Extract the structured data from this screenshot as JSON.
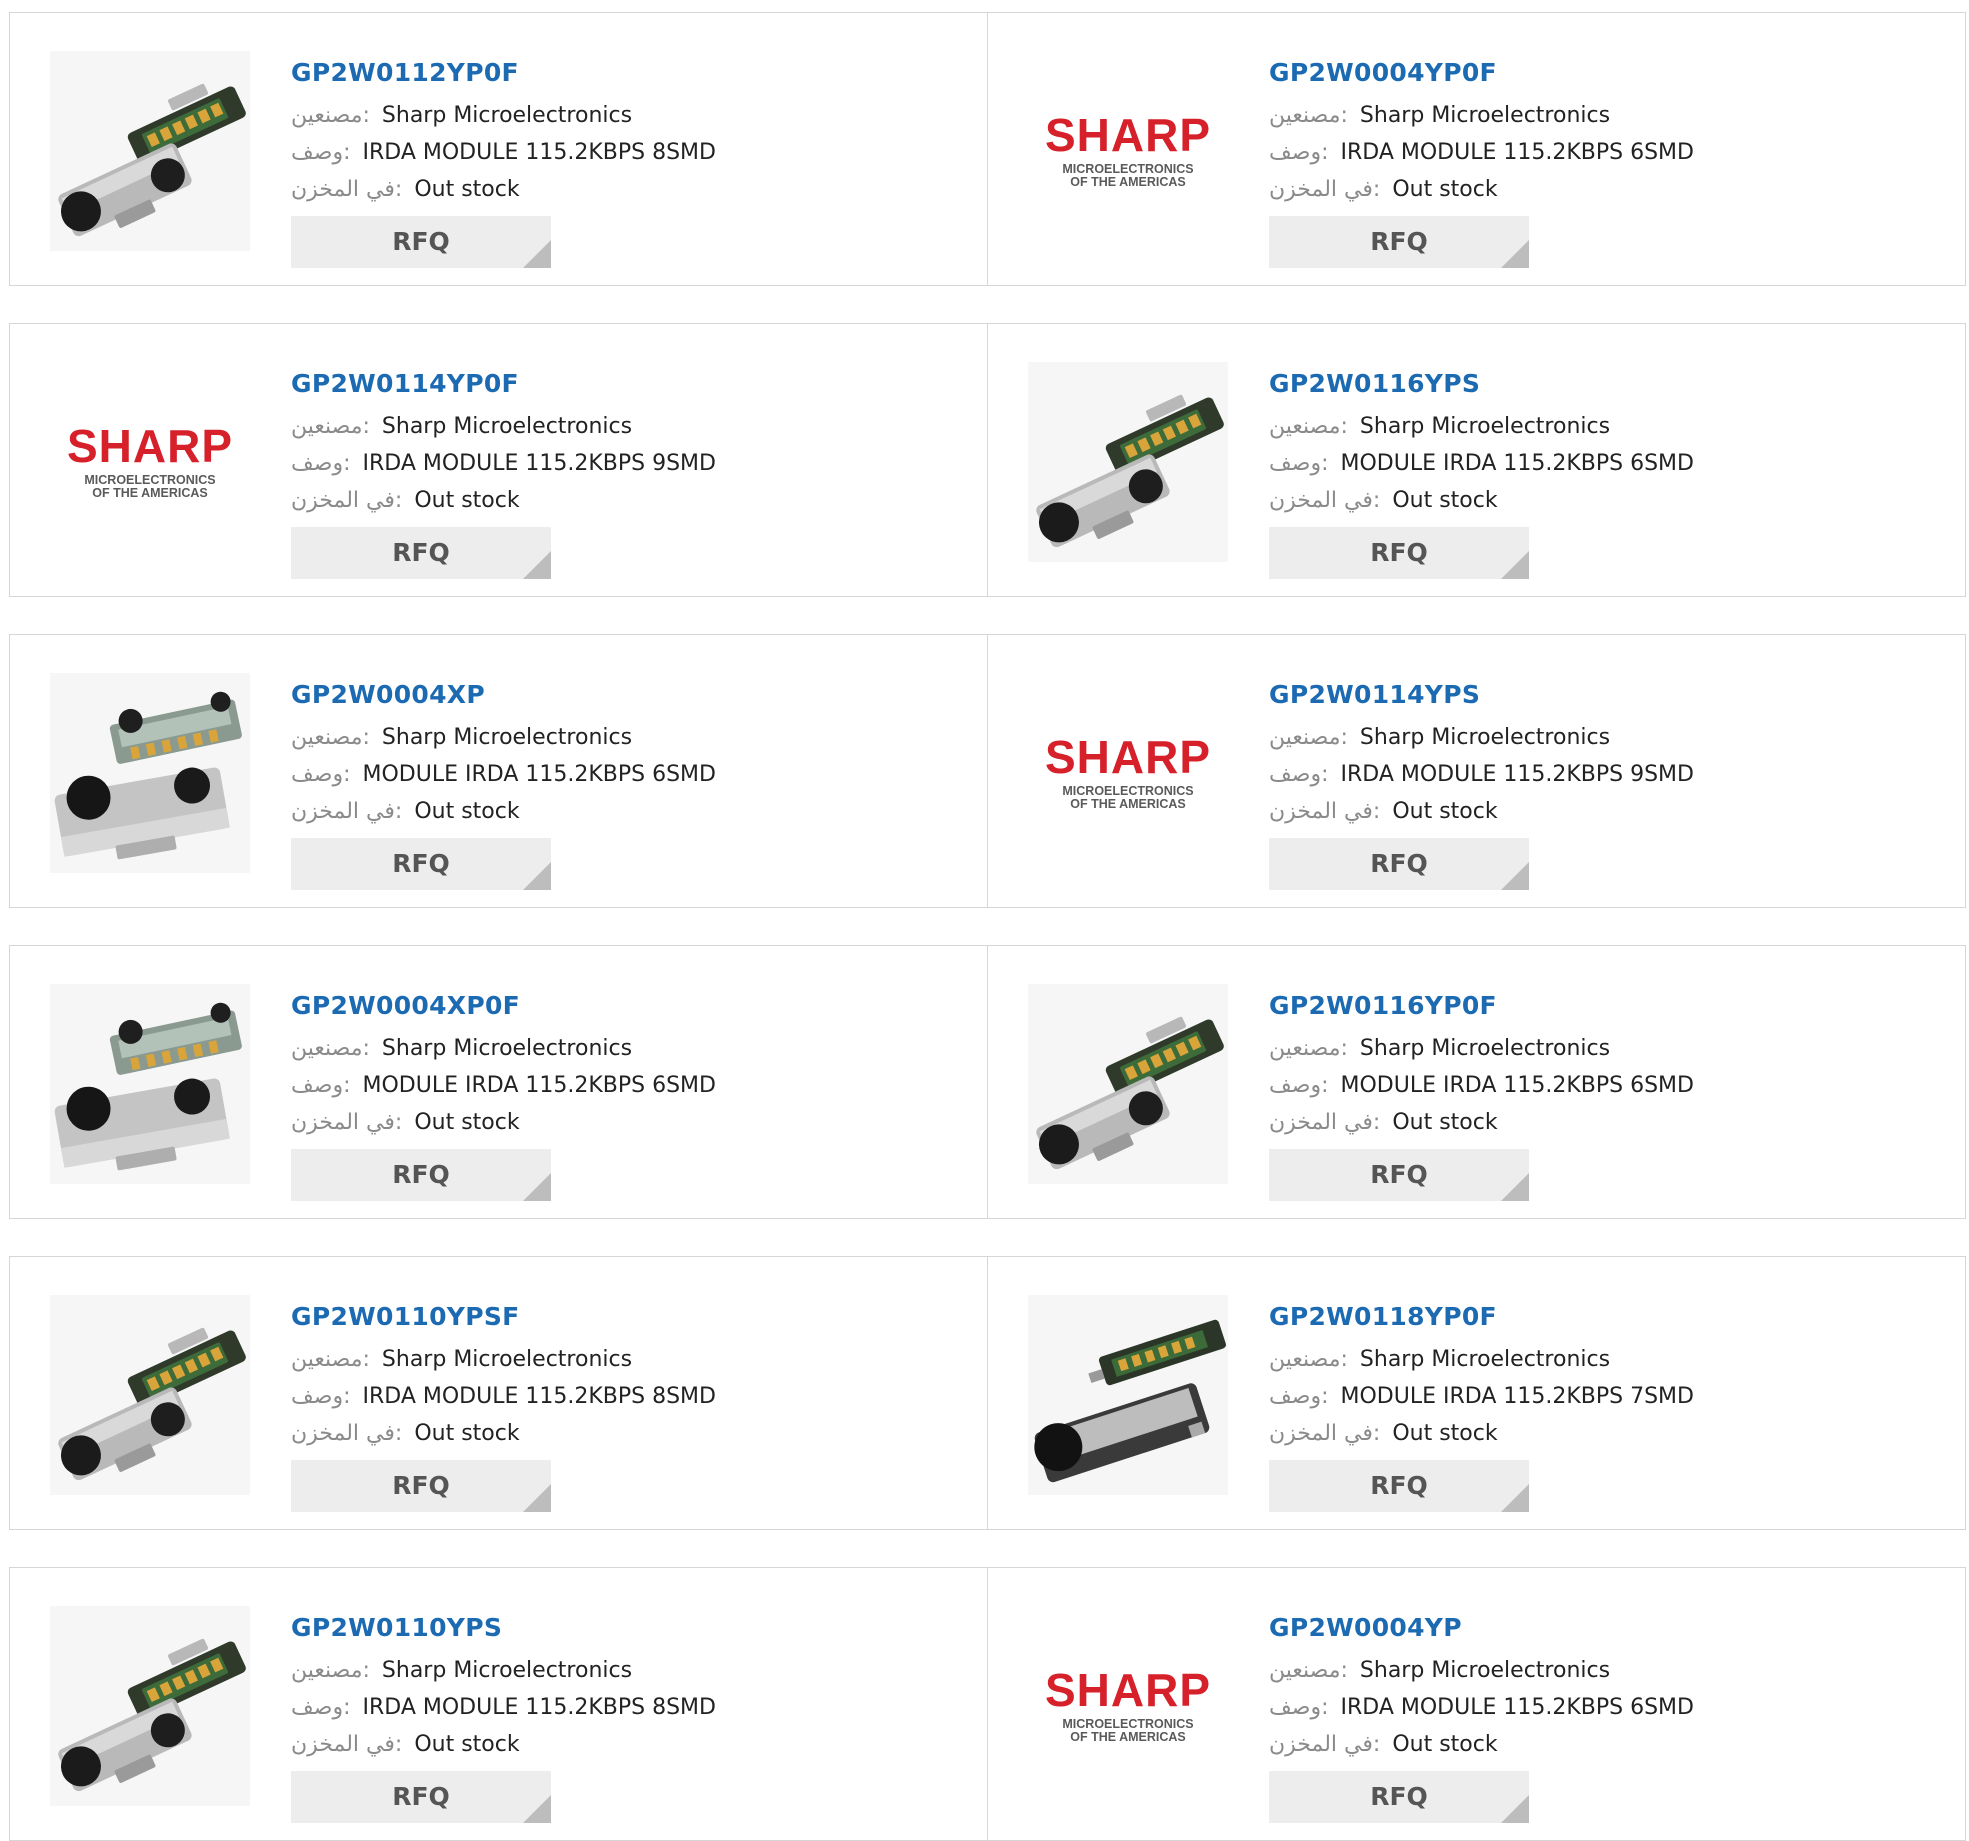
{
  "labels": {
    "manufacturer": "مصنعين:",
    "description": "وصف:",
    "stock": "في المخزن:",
    "rfq": "RFQ"
  },
  "logo": {
    "brand": "SHARP",
    "line1": "MICROELECTRONICS",
    "line2": "OF THE AMERICAS",
    "brand_color": "#d6202a"
  },
  "colors": {
    "part_link": "#1b6ab2",
    "border": "#d6d6d6",
    "rfq_bg": "#ededed"
  },
  "products": [
    {
      "part": "GP2W0112YP0F",
      "manufacturer": "Sharp Microelectronics",
      "description": "IRDA MODULE 115.2KBPS 8SMD",
      "stock": "Out stock",
      "image": "irda-module-diagonal"
    },
    {
      "part": "GP2W0004YP0F",
      "manufacturer": "Sharp Microelectronics",
      "description": "IRDA MODULE 115.2KBPS 6SMD",
      "stock": "Out stock",
      "image": "sharp-logo"
    },
    {
      "part": "GP2W0114YP0F",
      "manufacturer": "Sharp Microelectronics",
      "description": "IRDA MODULE 115.2KBPS 9SMD",
      "stock": "Out stock",
      "image": "sharp-logo"
    },
    {
      "part": "GP2W0116YPS",
      "manufacturer": "Sharp Microelectronics",
      "description": "MODULE IRDA 115.2KBPS 6SMD",
      "stock": "Out stock",
      "image": "irda-module-diagonal"
    },
    {
      "part": "GP2W0004XP",
      "manufacturer": "Sharp Microelectronics",
      "description": "MODULE IRDA 115.2KBPS 6SMD",
      "stock": "Out stock",
      "image": "irda-module-flat"
    },
    {
      "part": "GP2W0114YPS",
      "manufacturer": "Sharp Microelectronics",
      "description": "IRDA MODULE 115.2KBPS 9SMD",
      "stock": "Out stock",
      "image": "sharp-logo"
    },
    {
      "part": "GP2W0004XP0F",
      "manufacturer": "Sharp Microelectronics",
      "description": "MODULE IRDA 115.2KBPS 6SMD",
      "stock": "Out stock",
      "image": "irda-module-flat"
    },
    {
      "part": "GP2W0116YP0F",
      "manufacturer": "Sharp Microelectronics",
      "description": "MODULE IRDA 115.2KBPS 6SMD",
      "stock": "Out stock",
      "image": "irda-module-diagonal"
    },
    {
      "part": "GP2W0110YPSF",
      "manufacturer": "Sharp Microelectronics",
      "description": "IRDA MODULE 115.2KBPS 8SMD",
      "stock": "Out stock",
      "image": "irda-module-diagonal"
    },
    {
      "part": "GP2W0118YP0F",
      "manufacturer": "Sharp Microelectronics",
      "description": "MODULE IRDA 115.2KBPS 7SMD",
      "stock": "Out stock",
      "image": "irda-module-single"
    },
    {
      "part": "GP2W0110YPS",
      "manufacturer": "Sharp Microelectronics",
      "description": "IRDA MODULE 115.2KBPS 8SMD",
      "stock": "Out stock",
      "image": "irda-module-diagonal"
    },
    {
      "part": "GP2W0004YP",
      "manufacturer": "Sharp Microelectronics",
      "description": "IRDA MODULE 115.2KBPS 6SMD",
      "stock": "Out stock",
      "image": "sharp-logo"
    }
  ]
}
